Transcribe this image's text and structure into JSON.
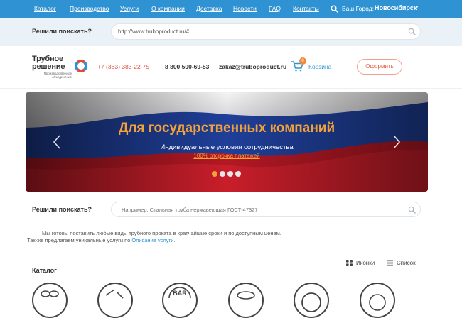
{
  "topnav": {
    "items": [
      "Каталог",
      "Производство",
      "Услуги",
      "О компании",
      "Доставка",
      "Новости",
      "FAQ",
      "Контакты"
    ],
    "city_label": "Ваш Город:",
    "city_value": "Новосибирск"
  },
  "search_top": {
    "label": "Решили поискать?",
    "value": "http://www.truboproduct.ru/#"
  },
  "header": {
    "logo_line1": "Трубное",
    "logo_line2": "решение",
    "logo_tagline": "Производственное объединение",
    "phone": "+7 (383) 383-22-75",
    "phone_free": "8 800 500-69-53",
    "email": "zakaz@truboproduct.ru",
    "cart_count": "0",
    "cart_label": "Корзина",
    "order_label": "Оформить"
  },
  "banner": {
    "title": "Для государственных компаний",
    "subtitle": "Индивидуальные условия сотрудничества",
    "link": "100% отсрочка платежей",
    "slides": 4,
    "active_slide": 1
  },
  "search_main": {
    "label": "Решили поискать?",
    "placeholder": "Например: Стальная труба нержавеющая ГОСТ-47327"
  },
  "intro": {
    "line1": "Мы готовы поставить любые виды трубного проката в кратчайшие сроки и по доступным ценам.",
    "line2_prefix": "Так-же предлагаем уникальные услуги по ",
    "line2_link": "Описание услуги.."
  },
  "view": {
    "icons_label": "Иконки",
    "list_label": "Список"
  },
  "catalog": {
    "title": "Каталог",
    "bar_label": "BAR"
  },
  "colors": {
    "nav_blue": "#2f93d3",
    "accent_orange": "#f2a23a",
    "phone_red": "#e04b3a"
  }
}
